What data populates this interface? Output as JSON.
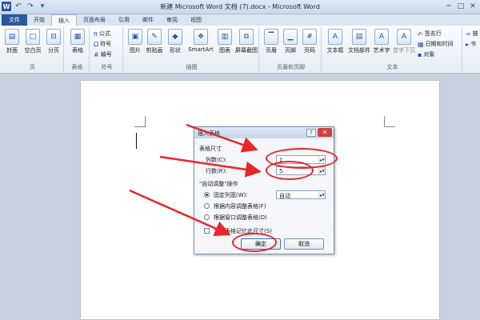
{
  "window": {
    "title": "新建 Microsoft Word 文档 (7).docx - Microsoft Word",
    "app_icon": "W",
    "undo_icon": "↶",
    "redo_icon": "↷",
    "qat_dropdown": "▾",
    "minimize": "─",
    "maximize": "□",
    "close": "✕"
  },
  "tabs": [
    "文件",
    "开始",
    "插入",
    "页面布局",
    "引用",
    "邮件",
    "审阅",
    "视图"
  ],
  "active_tab": "插入",
  "ribbon": {
    "groups": {
      "pages": {
        "label": "页",
        "buttons": [
          "封面",
          "空白页",
          "分页"
        ]
      },
      "tables": {
        "label": "表格",
        "buttons": [
          "表格"
        ]
      },
      "symbols": {
        "label": "符号",
        "items": [
          "公式",
          "符号",
          "编号"
        ]
      },
      "illustrations": {
        "label": "插图",
        "buttons": [
          "图片",
          "剪贴画",
          "形状",
          "SmartArt",
          "图表",
          "屏幕截图"
        ]
      },
      "header_footer": {
        "label": "页眉和页脚",
        "buttons": [
          "页眉",
          "页脚",
          "页码"
        ]
      },
      "text": {
        "label": "文本",
        "buttons": [
          "文本框",
          "文档部件",
          "艺术字",
          "首字下沉"
        ],
        "items": [
          "签名行",
          "日期和时间",
          "对象"
        ]
      },
      "links": {
        "buttons": [
          "链",
          "书"
        ]
      }
    }
  },
  "dialog": {
    "title": "插入表格",
    "help_label": "?",
    "close_label": "✕",
    "section_size": "表格尺寸",
    "columns_label": "列数(C):",
    "columns_value": "1",
    "rows_label": "行数(R):",
    "rows_value": "5",
    "section_autofit": "\"自动调整\"操作",
    "fixed_width_label": "固定列宽(W):",
    "fixed_width_value": "自动",
    "autofit_content_label": "根据内容调整表格(F)",
    "autofit_window_label": "根据窗口调整表格(D)",
    "remember_label": "为新表格记忆此尺寸(S)",
    "ok_label": "确定",
    "cancel_label": "取消"
  },
  "annotation": {
    "color": "#e8262a"
  }
}
